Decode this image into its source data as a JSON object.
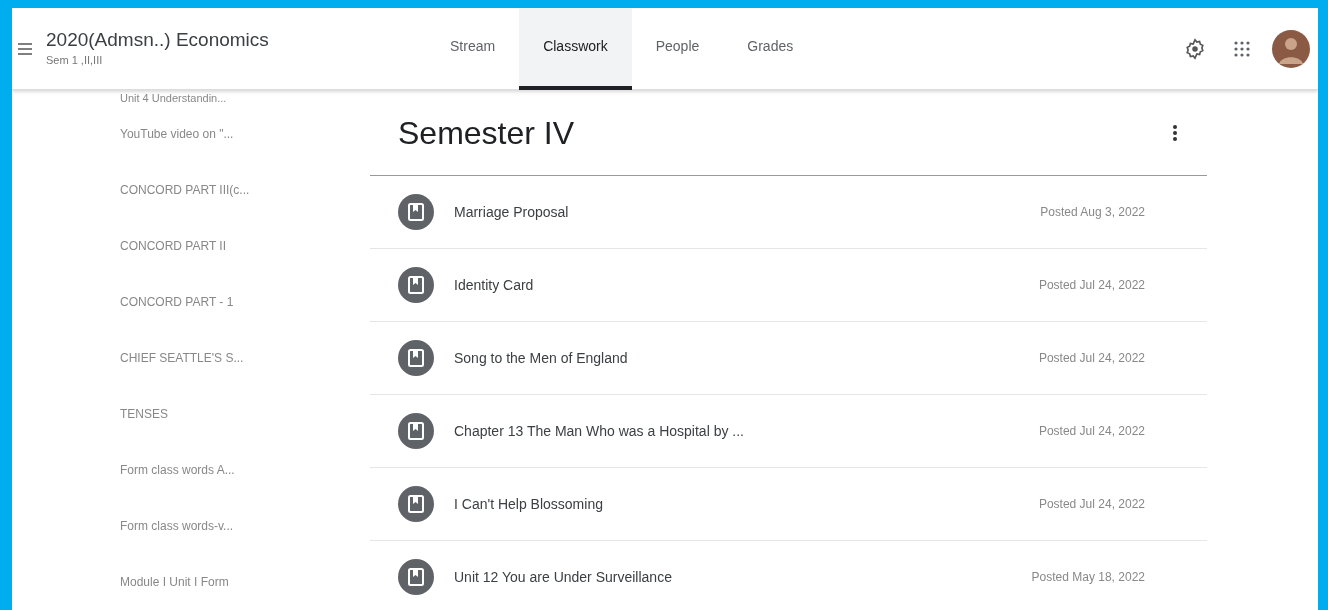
{
  "header": {
    "class_title": "2020(Admsn..) Economics",
    "class_subtitle": "Sem 1 ,II,III"
  },
  "tabs": [
    {
      "label": "Stream",
      "selected": false
    },
    {
      "label": "Classwork",
      "selected": true
    },
    {
      "label": "People",
      "selected": false
    },
    {
      "label": "Grades",
      "selected": false
    }
  ],
  "sidebar": {
    "items": [
      "Unit 4 Understandin...",
      "YouTube video on \"...",
      "CONCORD PART III(c...",
      "CONCORD PART II",
      "CONCORD PART - 1",
      "CHIEF SEATTLE'S S...",
      "TENSES",
      "Form class words A...",
      "Form class words-v...",
      "Module I Unit I Form"
    ]
  },
  "topic": {
    "title": "Semester IV",
    "items": [
      {
        "title": "Marriage Proposal",
        "posted": "Posted Aug 3, 2022"
      },
      {
        "title": "Identity Card",
        "posted": "Posted Jul 24, 2022"
      },
      {
        "title": "Song to the Men of England",
        "posted": "Posted Jul 24, 2022"
      },
      {
        "title": "Chapter 13 The Man Who was a Hospital by ...",
        "posted": "Posted Jul 24, 2022"
      },
      {
        "title": "I Can't Help Blossoming",
        "posted": "Posted Jul 24, 2022"
      },
      {
        "title": "Unit 12 You are Under Surveillance",
        "posted": "Posted May 18, 2022"
      }
    ]
  }
}
